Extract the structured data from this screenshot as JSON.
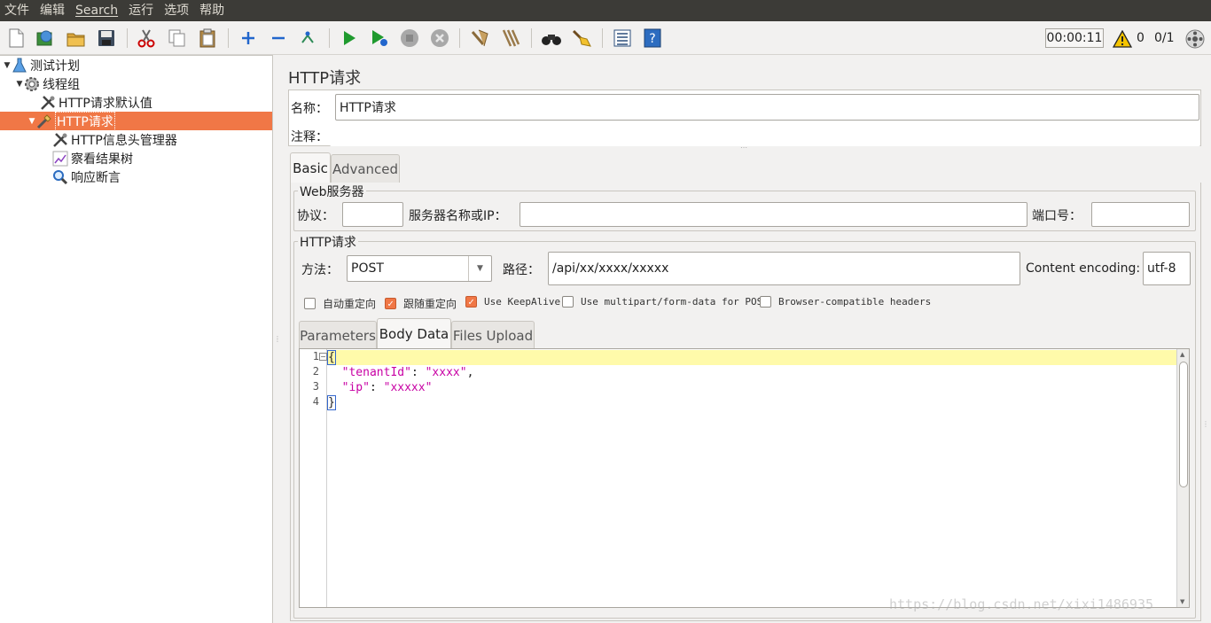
{
  "menubar": {
    "items": [
      "文件",
      "编辑",
      "Search",
      "运行",
      "选项",
      "帮助"
    ]
  },
  "toolbar": {
    "buttons": [
      "new-icon",
      "templates-icon",
      "open-icon",
      "save-icon",
      "cut-icon",
      "copy-icon",
      "paste-icon",
      "expand-icon",
      "collapse-icon",
      "toggle-icon",
      "start-icon",
      "start-no-pause-icon",
      "stop-icon",
      "shutdown-icon",
      "clear-icon",
      "clear-all-icon",
      "search-icon",
      "reset-search-icon",
      "function-helper-icon",
      "help-icon"
    ],
    "timer": "00:00:11",
    "warning_count": "0",
    "threads": "0/1"
  },
  "tree": {
    "items": [
      {
        "label": "测试计划",
        "icon": "test-plan-icon",
        "depth": 0,
        "expanded": true
      },
      {
        "label": "线程组",
        "icon": "thread-group-icon",
        "depth": 1,
        "expanded": true
      },
      {
        "label": "HTTP请求默认值",
        "icon": "config-icon",
        "depth": 2
      },
      {
        "label": "HTTP请求",
        "icon": "sampler-icon",
        "depth": 2,
        "expanded": true,
        "selected": true
      },
      {
        "label": "HTTP信息头管理器",
        "icon": "config-icon",
        "depth": 3
      },
      {
        "label": "察看结果树",
        "icon": "listener-icon",
        "depth": 3
      },
      {
        "label": "响应断言",
        "icon": "assertion-icon",
        "depth": 3
      }
    ]
  },
  "panel": {
    "title": "HTTP请求",
    "name_label": "名称：",
    "name_value": "HTTP请求",
    "comment_label": "注释：",
    "comment_value": ""
  },
  "tabs": {
    "basic": "Basic",
    "advanced": "Advanced"
  },
  "web_server": {
    "group_title": "Web服务器",
    "protocol_label": "协议：",
    "protocol_value": "",
    "server_label": "服务器名称或IP：",
    "server_value": "",
    "port_label": "端口号：",
    "port_value": ""
  },
  "http_request": {
    "group_title": "HTTP请求",
    "method_label": "方法：",
    "method_value": "POST",
    "path_label": "路径：",
    "path_value": "/api/xx/xxxx/xxxxx",
    "encoding_label": "Content encoding:",
    "encoding_value": "utf-8"
  },
  "checkboxes": [
    {
      "label": "自动重定向",
      "checked": false
    },
    {
      "label": "跟随重定向",
      "checked": true
    },
    {
      "label": "Use KeepAlive",
      "checked": true
    },
    {
      "label": "Use multipart/form-data for POST",
      "checked": false
    },
    {
      "label": "Browser-compatible headers",
      "checked": false
    }
  ],
  "subtabs": {
    "parameters": "Parameters",
    "body_data": "Body Data",
    "files_upload": "Files Upload"
  },
  "editor": {
    "line_numbers": [
      "1",
      "2",
      "3",
      "4"
    ],
    "lines": {
      "l1": "{",
      "l2_key": "\"tenantId\"",
      "l2_colon": ": ",
      "l2_val": "\"xxxx\"",
      "l2_comma": ",",
      "l3_key": "\"ip\"",
      "l3_colon": ": ",
      "l3_val": "\"xxxxx\"",
      "l4": "}"
    }
  },
  "watermark": "https://blog.csdn.net/xixi1486935"
}
